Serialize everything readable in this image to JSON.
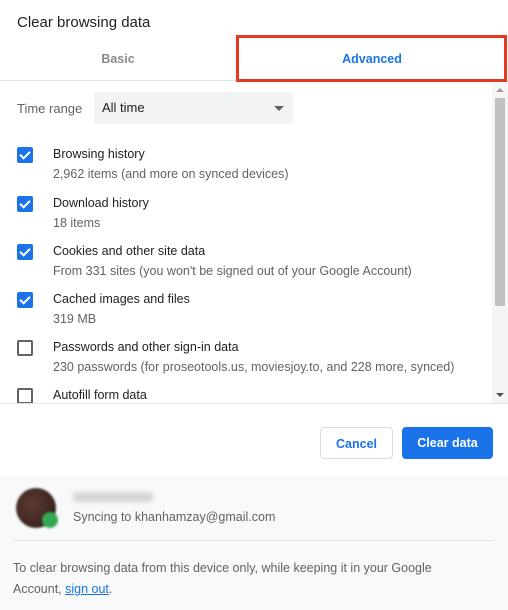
{
  "dialog": {
    "title": "Clear browsing data",
    "tabs": [
      {
        "label": "Basic",
        "selected": false
      },
      {
        "label": "Advanced",
        "selected": true
      }
    ],
    "annotation": {
      "target": "Advanced tab",
      "color": "#e53a1f"
    }
  },
  "time_range": {
    "label": "Time range",
    "value": "All time"
  },
  "items": [
    {
      "label": "Browsing history",
      "sub": "2,962 items (and more on synced devices)",
      "checked": true
    },
    {
      "label": "Download history",
      "sub": "18 items",
      "checked": true
    },
    {
      "label": "Cookies and other site data",
      "sub": "From 331 sites (you won't be signed out of your Google Account)",
      "checked": true
    },
    {
      "label": "Cached images and files",
      "sub": "319 MB",
      "checked": true
    },
    {
      "label": "Passwords and other sign-in data",
      "sub": "230 passwords (for proseotools.us, moviesjoy.to, and 228 more, synced)",
      "checked": false
    },
    {
      "label": "Autofill form data",
      "sub": "",
      "checked": false
    }
  ],
  "buttons": {
    "cancel": "Cancel",
    "clear": "Clear data"
  },
  "footer": {
    "sync_text": "Syncing to khanhamzay@gmail.com",
    "info_text": "To clear browsing data from this device only, while keeping it in your Google Account, ",
    "link_text": "sign out",
    "info_end": "."
  },
  "colors": {
    "accent": "#1a73e8",
    "annotation": "#e53a1f",
    "sync_badge": "#34a853"
  }
}
